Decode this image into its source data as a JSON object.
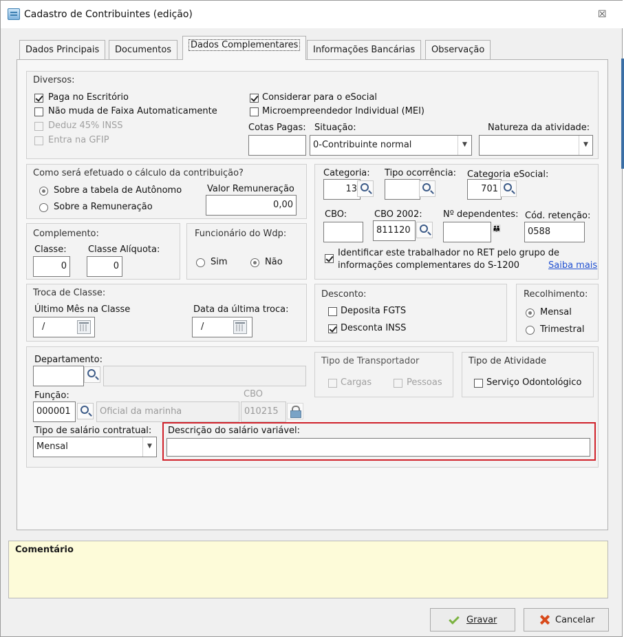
{
  "window": {
    "title": "Cadastro de Contribuintes (edição)",
    "close_glyph": "☒"
  },
  "tabs": [
    {
      "label": "Dados Principais",
      "active": false
    },
    {
      "label": "Documentos",
      "active": false
    },
    {
      "label": "Dados Complementares",
      "active": true
    },
    {
      "label": "Informações Bancárias",
      "active": false
    },
    {
      "label": "Observação",
      "active": false
    }
  ],
  "diversos": {
    "title": "Diversos:",
    "checks": [
      {
        "label": "Paga no Escritório",
        "checked": true,
        "enabled": true
      },
      {
        "label": "Não muda de Faixa Automaticamente",
        "checked": false,
        "enabled": true
      },
      {
        "label": "Deduz 45% INSS",
        "checked": false,
        "enabled": false
      },
      {
        "label": "Entra na GFIP",
        "checked": false,
        "enabled": false
      },
      {
        "label": "Considerar para o eSocial",
        "checked": true,
        "enabled": true
      },
      {
        "label": "Microempreendedor Individual (MEI)",
        "checked": false,
        "enabled": true
      }
    ],
    "cotas_label": "Cotas Pagas:",
    "cotas_value": "",
    "situacao_label": "Situação:",
    "situacao_value": "0-Contribuinte normal",
    "natureza_label": "Natureza da atividade:",
    "natureza_value": ""
  },
  "calculo": {
    "title": "Como será efetuado o cálculo da contribuição?",
    "opt1": "Sobre a tabela de Autônomo",
    "opt2": "Sobre a Remuneração",
    "selected": 1,
    "valor_label": "Valor Remuneração",
    "valor_value": "0,00"
  },
  "complemento": {
    "title": "Complemento:",
    "classe_label": "Classe:",
    "classe_value": "0",
    "aliquota_label": "Classe Alíquota:",
    "aliquota_value": "0"
  },
  "funcionario": {
    "title": "Funcionário do Wdp:",
    "sim": "Sim",
    "nao": "Não",
    "selected": "nao"
  },
  "troca": {
    "title": "Troca de Classe:",
    "ultimo_label": "Último Mês na Classe",
    "ultimo_value": "/",
    "data_label": "Data da última troca:",
    "data_value": "/"
  },
  "categoria": {
    "categoria_label": "Categoria:",
    "categoria_value": "13",
    "tipo_oc_label": "Tipo ocorrência:",
    "tipo_oc_value": "",
    "cat_esocial_label": "Categoria eSocial:",
    "cat_esocial_value": "701",
    "cbo_label": "CBO:",
    "cbo_value": "",
    "cbo2002_label": "CBO 2002:",
    "cbo2002_value": "811120",
    "dependentes_label": "Nº dependentes:",
    "dependentes_value": "",
    "retencao_label": "Cód. retenção:",
    "retencao_value": "0588",
    "ret_check_line1": "Identificar este trabalhador no RET pelo grupo de",
    "ret_check_line2": "informações complementares do S-1200",
    "ret_checked": true,
    "saiba_mais": "Saiba mais"
  },
  "desconto": {
    "title": "Desconto:",
    "fgts": "Deposita FGTS",
    "fgts_checked": false,
    "inss": "Desconta INSS",
    "inss_checked": true
  },
  "recolhimento": {
    "title": "Recolhimento:",
    "mensal": "Mensal",
    "trimestral": "Trimestral",
    "selected": "mensal"
  },
  "depto": {
    "depto_label": "Departamento:",
    "depto_value": "",
    "depto_desc": "",
    "funcao_label": "Função:",
    "funcao_value": "000001",
    "funcao_desc": "Oficial da marinha",
    "cbo_label": "CBO",
    "cbo_value": "010215",
    "tipo_salario_label": "Tipo de salário contratual:",
    "tipo_salario_value": "Mensal",
    "descricao_label": "Descrição do salário variável:",
    "descricao_value": ""
  },
  "transportador": {
    "title": "Tipo de Transportador",
    "cargas": "Cargas",
    "pessoas": "Pessoas"
  },
  "atividade": {
    "title": "Tipo de Atividade",
    "odonto": "Serviço Odontológico",
    "odonto_checked": false
  },
  "comment": {
    "label": "Comentário"
  },
  "buttons": {
    "save": "Gravar",
    "cancel": "Cancelar"
  }
}
